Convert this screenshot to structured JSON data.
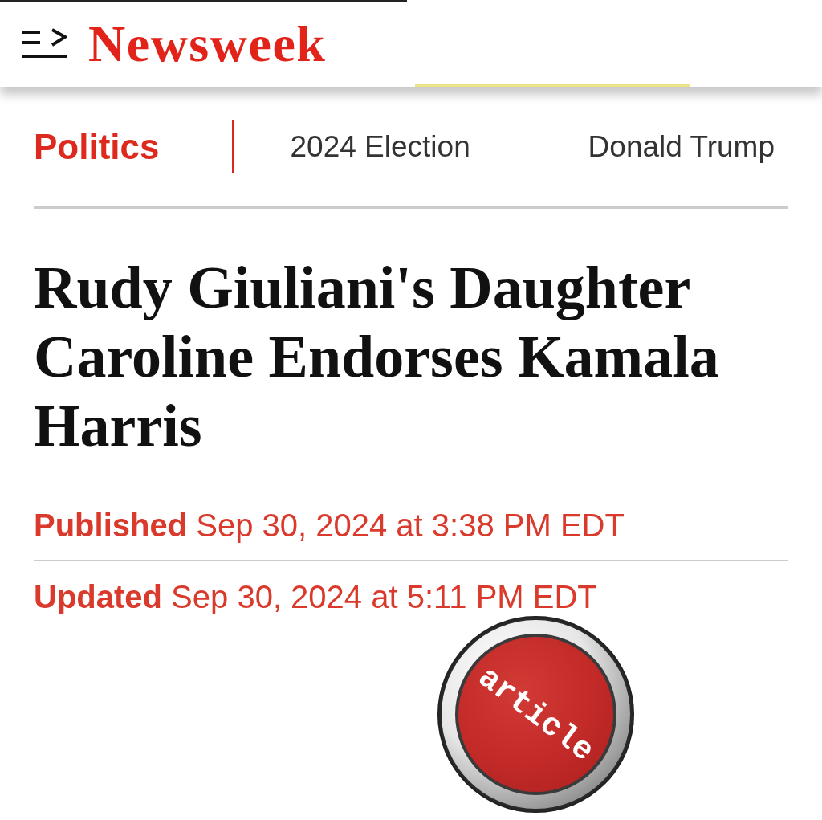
{
  "top_bar": {
    "logo": "Newsweek"
  },
  "nav": {
    "items": [
      {
        "label": "Politics",
        "selected": true
      },
      {
        "label": "2024 Election",
        "selected": false
      },
      {
        "label": "Donald Trump",
        "selected": false
      }
    ]
  },
  "headline": "Rudy Giuliani's Daughter Caroline Endorses Kamala Harris",
  "dates": [
    "**Published** Sep 30, 2024 at 3:38 PM EDT",
    "**Updated** Sep 30, 2024 at 5:11 PM EDT"
  ],
  "sticker": {
    "label": "article"
  }
}
